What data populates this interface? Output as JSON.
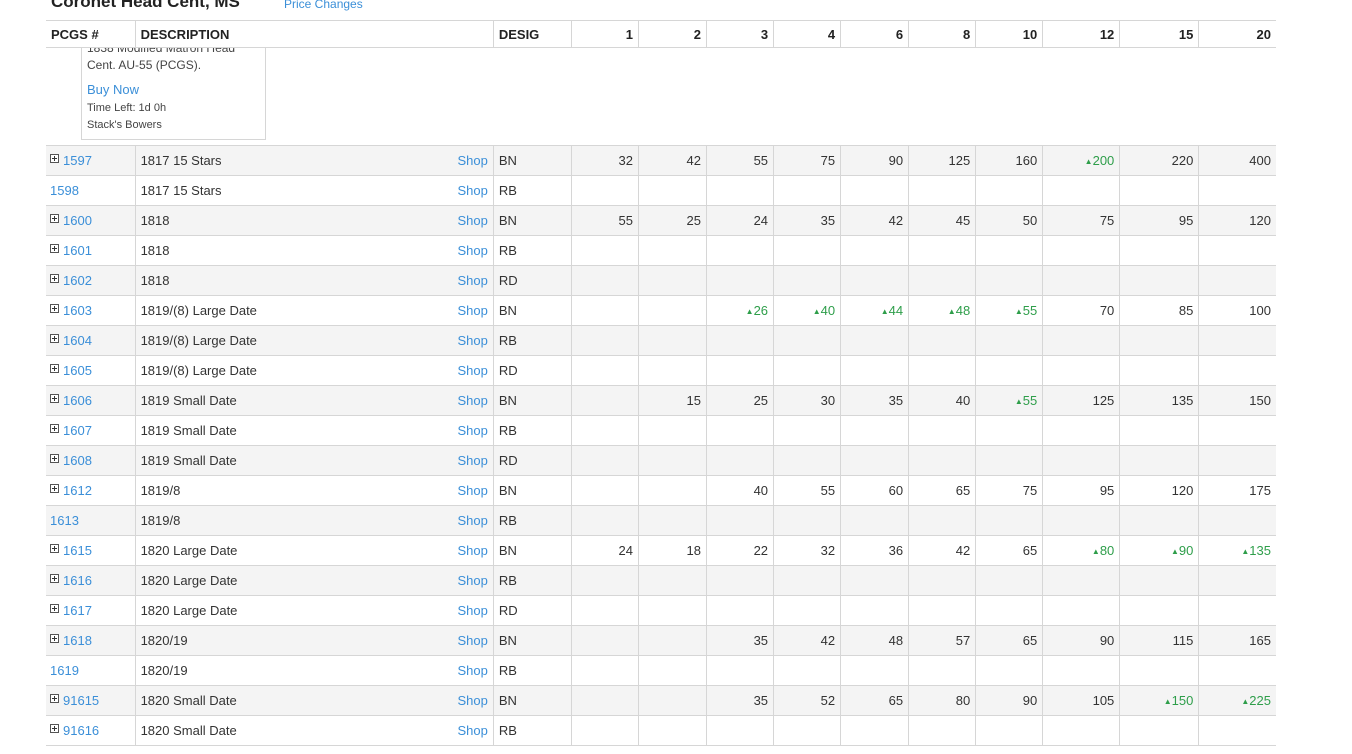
{
  "header": {
    "title": "Coronet Head Cent, MS",
    "price_changes_label": "Price Changes"
  },
  "table": {
    "columns": {
      "pcgs": "PCGS #",
      "description": "DESCRIPTION",
      "desig": "DESIG",
      "grades": [
        "1",
        "2",
        "3",
        "4",
        "6",
        "8",
        "10",
        "12",
        "15",
        "20"
      ]
    },
    "ad": {
      "description": "1838 Modified Matron Head Cent. AU-55 (PCGS).",
      "buy_label": "Buy Now",
      "time_left": "Time Left: 1d 0h",
      "seller": "Stack's Bowers"
    },
    "shop_label": "Shop",
    "rows": [
      {
        "pcgs": "1597",
        "expandable": true,
        "description": "1817 15 Stars",
        "desig": "BN",
        "prices": [
          "32",
          "42",
          "55",
          "75",
          "90",
          "125",
          "160",
          "200",
          "220",
          "400"
        ],
        "up": [
          false,
          false,
          false,
          false,
          false,
          false,
          false,
          true,
          false,
          false
        ]
      },
      {
        "pcgs": "1598",
        "expandable": false,
        "description": "1817 15 Stars",
        "desig": "RB",
        "prices": [
          "",
          "",
          "",
          "",
          "",
          "",
          "",
          "",
          "",
          ""
        ],
        "up": [
          false,
          false,
          false,
          false,
          false,
          false,
          false,
          false,
          false,
          false
        ]
      },
      {
        "pcgs": "1600",
        "expandable": true,
        "description": "1818",
        "desig": "BN",
        "prices": [
          "55",
          "25",
          "24",
          "35",
          "42",
          "45",
          "50",
          "75",
          "95",
          "120"
        ],
        "up": [
          false,
          false,
          false,
          false,
          false,
          false,
          false,
          false,
          false,
          false
        ]
      },
      {
        "pcgs": "1601",
        "expandable": true,
        "description": "1818",
        "desig": "RB",
        "prices": [
          "",
          "",
          "",
          "",
          "",
          "",
          "",
          "",
          "",
          ""
        ],
        "up": [
          false,
          false,
          false,
          false,
          false,
          false,
          false,
          false,
          false,
          false
        ]
      },
      {
        "pcgs": "1602",
        "expandable": true,
        "description": "1818",
        "desig": "RD",
        "prices": [
          "",
          "",
          "",
          "",
          "",
          "",
          "",
          "",
          "",
          ""
        ],
        "up": [
          false,
          false,
          false,
          false,
          false,
          false,
          false,
          false,
          false,
          false
        ]
      },
      {
        "pcgs": "1603",
        "expandable": true,
        "description": "1819/(8) Large Date",
        "desig": "BN",
        "prices": [
          "",
          "",
          "26",
          "40",
          "44",
          "48",
          "55",
          "70",
          "85",
          "100"
        ],
        "up": [
          false,
          false,
          true,
          true,
          true,
          true,
          true,
          false,
          false,
          false
        ]
      },
      {
        "pcgs": "1604",
        "expandable": true,
        "description": "1819/(8) Large Date",
        "desig": "RB",
        "prices": [
          "",
          "",
          "",
          "",
          "",
          "",
          "",
          "",
          "",
          ""
        ],
        "up": [
          false,
          false,
          false,
          false,
          false,
          false,
          false,
          false,
          false,
          false
        ]
      },
      {
        "pcgs": "1605",
        "expandable": true,
        "description": "1819/(8) Large Date",
        "desig": "RD",
        "prices": [
          "",
          "",
          "",
          "",
          "",
          "",
          "",
          "",
          "",
          ""
        ],
        "up": [
          false,
          false,
          false,
          false,
          false,
          false,
          false,
          false,
          false,
          false
        ]
      },
      {
        "pcgs": "1606",
        "expandable": true,
        "description": "1819 Small Date",
        "desig": "BN",
        "prices": [
          "",
          "15",
          "25",
          "30",
          "35",
          "40",
          "55",
          "125",
          "135",
          "150"
        ],
        "up": [
          false,
          false,
          false,
          false,
          false,
          false,
          true,
          false,
          false,
          false
        ]
      },
      {
        "pcgs": "1607",
        "expandable": true,
        "description": "1819 Small Date",
        "desig": "RB",
        "prices": [
          "",
          "",
          "",
          "",
          "",
          "",
          "",
          "",
          "",
          ""
        ],
        "up": [
          false,
          false,
          false,
          false,
          false,
          false,
          false,
          false,
          false,
          false
        ]
      },
      {
        "pcgs": "1608",
        "expandable": true,
        "description": "1819 Small Date",
        "desig": "RD",
        "prices": [
          "",
          "",
          "",
          "",
          "",
          "",
          "",
          "",
          "",
          ""
        ],
        "up": [
          false,
          false,
          false,
          false,
          false,
          false,
          false,
          false,
          false,
          false
        ]
      },
      {
        "pcgs": "1612",
        "expandable": true,
        "description": "1819/8",
        "desig": "BN",
        "prices": [
          "",
          "",
          "40",
          "55",
          "60",
          "65",
          "75",
          "95",
          "120",
          "175"
        ],
        "up": [
          false,
          false,
          false,
          false,
          false,
          false,
          false,
          false,
          false,
          false
        ]
      },
      {
        "pcgs": "1613",
        "expandable": false,
        "description": "1819/8",
        "desig": "RB",
        "prices": [
          "",
          "",
          "",
          "",
          "",
          "",
          "",
          "",
          "",
          ""
        ],
        "up": [
          false,
          false,
          false,
          false,
          false,
          false,
          false,
          false,
          false,
          false
        ]
      },
      {
        "pcgs": "1615",
        "expandable": true,
        "description": "1820 Large Date",
        "desig": "BN",
        "prices": [
          "24",
          "18",
          "22",
          "32",
          "36",
          "42",
          "65",
          "80",
          "90",
          "135"
        ],
        "up": [
          false,
          false,
          false,
          false,
          false,
          false,
          false,
          true,
          true,
          true
        ]
      },
      {
        "pcgs": "1616",
        "expandable": true,
        "description": "1820 Large Date",
        "desig": "RB",
        "prices": [
          "",
          "",
          "",
          "",
          "",
          "",
          "",
          "",
          "",
          ""
        ],
        "up": [
          false,
          false,
          false,
          false,
          false,
          false,
          false,
          false,
          false,
          false
        ]
      },
      {
        "pcgs": "1617",
        "expandable": true,
        "description": "1820 Large Date",
        "desig": "RD",
        "prices": [
          "",
          "",
          "",
          "",
          "",
          "",
          "",
          "",
          "",
          ""
        ],
        "up": [
          false,
          false,
          false,
          false,
          false,
          false,
          false,
          false,
          false,
          false
        ]
      },
      {
        "pcgs": "1618",
        "expandable": true,
        "description": "1820/19",
        "desig": "BN",
        "prices": [
          "",
          "",
          "35",
          "42",
          "48",
          "57",
          "65",
          "90",
          "115",
          "165"
        ],
        "up": [
          false,
          false,
          false,
          false,
          false,
          false,
          false,
          false,
          false,
          false
        ]
      },
      {
        "pcgs": "1619",
        "expandable": false,
        "description": "1820/19",
        "desig": "RB",
        "prices": [
          "",
          "",
          "",
          "",
          "",
          "",
          "",
          "",
          "",
          ""
        ],
        "up": [
          false,
          false,
          false,
          false,
          false,
          false,
          false,
          false,
          false,
          false
        ]
      },
      {
        "pcgs": "91615",
        "expandable": true,
        "description": "1820 Small Date",
        "desig": "BN",
        "prices": [
          "",
          "",
          "35",
          "52",
          "65",
          "80",
          "90",
          "105",
          "150",
          "225"
        ],
        "up": [
          false,
          false,
          false,
          false,
          false,
          false,
          false,
          false,
          true,
          true
        ]
      },
      {
        "pcgs": "91616",
        "expandable": true,
        "description": "1820 Small Date",
        "desig": "RB",
        "prices": [
          "",
          "",
          "",
          "",
          "",
          "",
          "",
          "",
          "",
          ""
        ],
        "up": [
          false,
          false,
          false,
          false,
          false,
          false,
          false,
          false,
          false,
          false
        ]
      }
    ]
  },
  "colors": {
    "link": "#3b8fd8",
    "increase": "#2e9e4a",
    "row_alt": "#f4f4f4",
    "border": "#d6d6d6"
  }
}
